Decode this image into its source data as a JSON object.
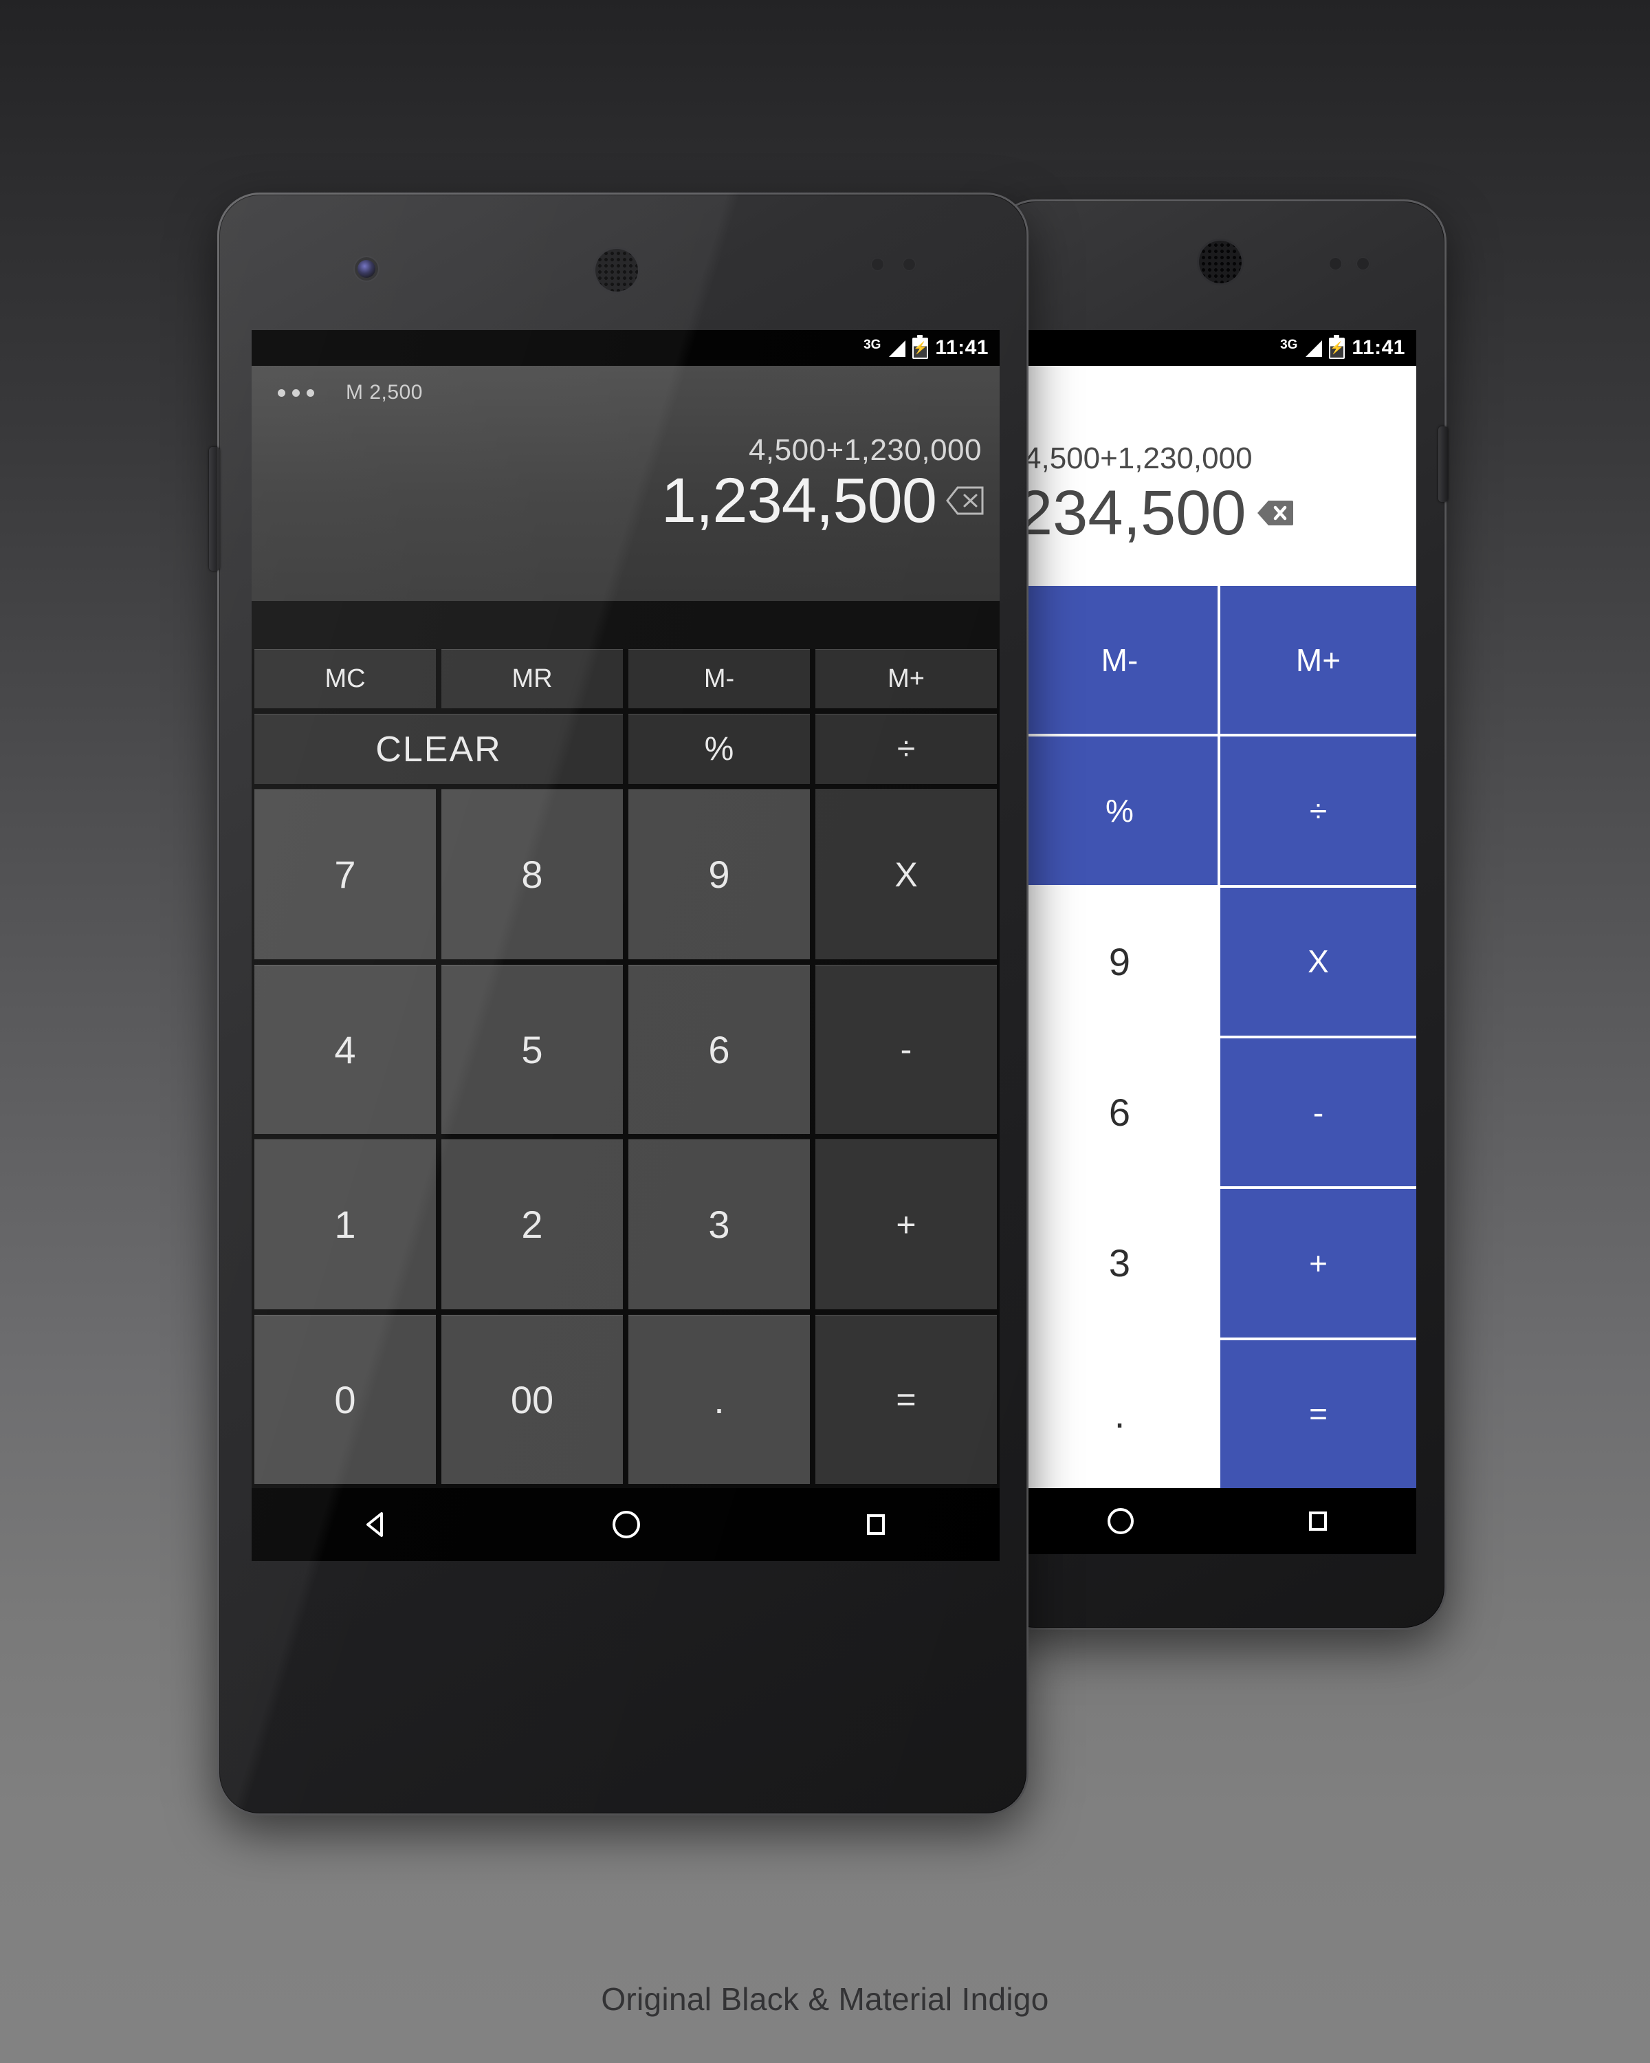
{
  "caption": "Original Black & Material Indigo",
  "colors": {
    "indigo": "#4054b2",
    "dark_key": "#2e2e2e",
    "num_key": "#494949",
    "op_key": "#333333",
    "display_dark": "#3c3c3c",
    "light_text": "#4a4a4a"
  },
  "status_bar": {
    "network_label": "3G",
    "signal_icon": "signal-bars-icon",
    "battery_icon": "battery-charging-icon",
    "clock": "11:41"
  },
  "dark_phone": {
    "name": "Original Black",
    "overflow_icon": "overflow-menu-icon",
    "memory_label": "M 2,500",
    "expression": "4,500+1,230,000",
    "result": "1,234,500",
    "backspace_icon": "backspace-outline-icon",
    "keys": [
      {
        "label": "MC",
        "type": "mem"
      },
      {
        "label": "MR",
        "type": "mem"
      },
      {
        "label": "M-",
        "type": "mem"
      },
      {
        "label": "M+",
        "type": "mem"
      },
      {
        "label": "CLEAR",
        "type": "clear"
      },
      {
        "label": "%",
        "type": "fn"
      },
      {
        "label": "÷",
        "type": "fn"
      },
      {
        "label": "7",
        "type": "num"
      },
      {
        "label": "8",
        "type": "num"
      },
      {
        "label": "9",
        "type": "num"
      },
      {
        "label": "X",
        "type": "op"
      },
      {
        "label": "4",
        "type": "num"
      },
      {
        "label": "5",
        "type": "num"
      },
      {
        "label": "6",
        "type": "num"
      },
      {
        "label": "-",
        "type": "op"
      },
      {
        "label": "1",
        "type": "num"
      },
      {
        "label": "2",
        "type": "num"
      },
      {
        "label": "3",
        "type": "num"
      },
      {
        "label": "+",
        "type": "op"
      },
      {
        "label": "0",
        "type": "num"
      },
      {
        "label": "00",
        "type": "num"
      },
      {
        "label": ".",
        "type": "num"
      },
      {
        "label": "=",
        "type": "op"
      }
    ],
    "navbar": [
      "back-icon",
      "home-icon",
      "recents-icon"
    ]
  },
  "indigo_phone": {
    "name": "Material Indigo",
    "expression": "4,500+1,230,000",
    "result": "234,500",
    "backspace_icon": "backspace-filled-icon",
    "keys": [
      {
        "label": "M-",
        "type": "ind"
      },
      {
        "label": "M+",
        "type": "ind"
      },
      {
        "label": "%",
        "type": "ind"
      },
      {
        "label": "÷",
        "type": "ind"
      },
      {
        "label": "9",
        "type": "num"
      },
      {
        "label": "X",
        "type": "ind"
      },
      {
        "label": "6",
        "type": "num"
      },
      {
        "label": "-",
        "type": "ind"
      },
      {
        "label": "3",
        "type": "num"
      },
      {
        "label": "+",
        "type": "ind"
      },
      {
        "label": ".",
        "type": "num"
      },
      {
        "label": "=",
        "type": "ind"
      }
    ],
    "navbar": [
      "home-icon",
      "recents-icon"
    ]
  }
}
